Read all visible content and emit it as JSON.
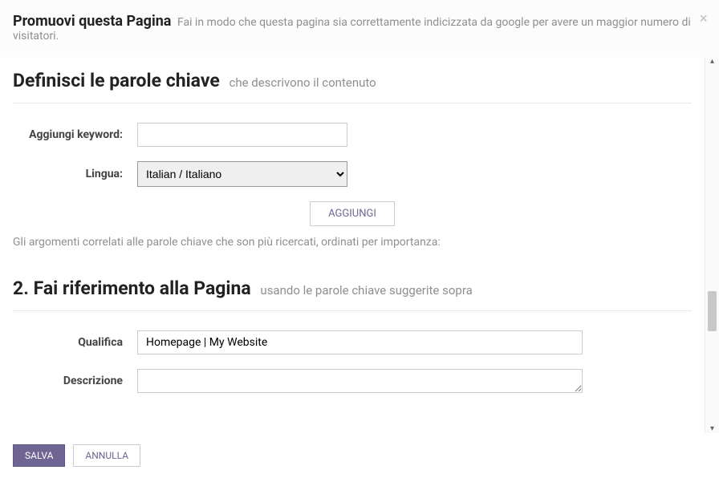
{
  "header": {
    "title": "Promuovi questa Pagina",
    "subtitle": "Fai in modo che questa pagina sia correttamente indicizzata da google per avere un maggior numero di visitatori.",
    "close": "×"
  },
  "section1": {
    "heading": "Definisci le parole chiave",
    "heading_sub": "che descrivono il contenuto",
    "keyword_label": "Aggiungi keyword:",
    "keyword_value": "",
    "language_label": "Lingua:",
    "language_options": [
      "Italian / Italiano"
    ],
    "language_value": "Italian / Italiano",
    "add_button": "AGGIUNGI",
    "hint": "Gli argomenti correlati alle parole chiave che son più ricercati, ordinati per importanza:"
  },
  "section2": {
    "heading": "2. Fai riferimento alla Pagina",
    "heading_sub": "usando le parole chiave suggerite sopra",
    "title_label": "Qualifica",
    "title_value": "Homepage | My Website",
    "desc_label": "Descrizione",
    "desc_value": ""
  },
  "footer": {
    "save": "SALVA",
    "cancel": "ANNULLA"
  }
}
